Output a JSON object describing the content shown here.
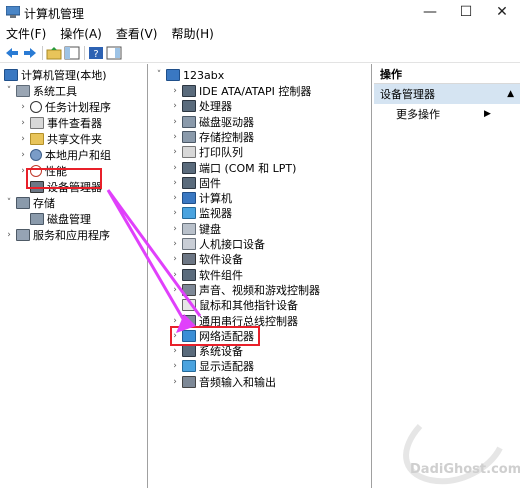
{
  "window": {
    "title": "计算机管理",
    "minimize": "—",
    "maximize": "☐",
    "close": "✕"
  },
  "menu": [
    "文件(F)",
    "操作(A)",
    "查看(V)",
    "帮助(H)"
  ],
  "toolbar_icons": [
    "back-arrow-icon",
    "forward-arrow-icon",
    "up-folder-icon",
    "show-hide-tree-icon",
    "help-icon",
    "properties-icon"
  ],
  "left_tree": {
    "root": "计算机管理(本地)",
    "system_tools": "系统工具",
    "task_scheduler": "任务计划程序",
    "event_viewer": "事件查看器",
    "shared_folders": "共享文件夹",
    "local_users": "本地用户和组",
    "performance": "性能",
    "device_manager": "设备管理器",
    "storage": "存储",
    "disk_management": "磁盘管理",
    "services": "服务和应用程序"
  },
  "device_tree": {
    "computer": "123abx",
    "items": [
      "IDE ATA/ATAPI 控制器",
      "处理器",
      "磁盘驱动器",
      "存储控制器",
      "打印队列",
      "端口 (COM 和 LPT)",
      "固件",
      "计算机",
      "监视器",
      "键盘",
      "人机接口设备",
      "软件设备",
      "软件组件",
      "声音、视频和游戏控制器",
      "鼠标和其他指针设备",
      "通用串行总线控制器",
      "网络适配器",
      "系统设备",
      "显示适配器",
      "音频输入和输出"
    ]
  },
  "actions": {
    "header": "操作",
    "selected": "设备管理器",
    "more": "更多操作"
  },
  "highlight_color": "#e8202a",
  "arrow_color": "#e040fb",
  "watermark": "DadiGhost.com"
}
